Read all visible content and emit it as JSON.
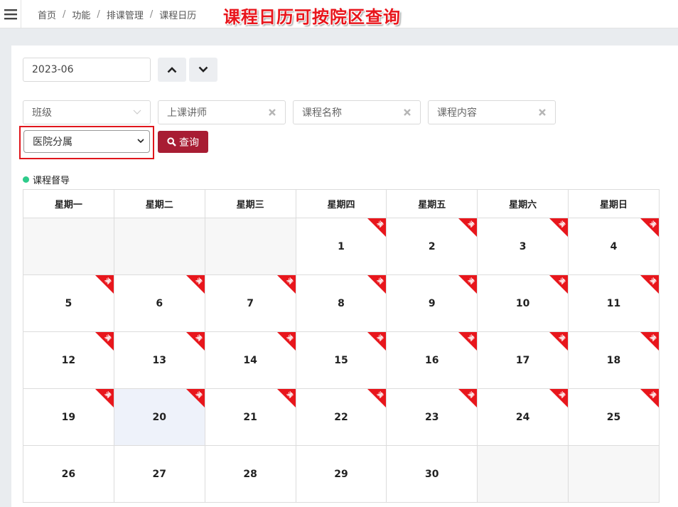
{
  "breadcrumb": [
    "首页",
    "功能",
    "排课管理",
    "课程日历"
  ],
  "annotation": "课程日历可按院区查询",
  "month_value": "2023-06",
  "filters": {
    "class_placeholder": "班级",
    "teacher_placeholder": "上课讲师",
    "course_name_placeholder": "课程名称",
    "course_content_placeholder": "课程内容",
    "hospital_selected": "医院分属"
  },
  "query_label": "查询",
  "legend_label": "课程督导",
  "weekdays": [
    "星期一",
    "星期二",
    "星期三",
    "星期四",
    "星期五",
    "星期六",
    "星期日"
  ],
  "weeks": [
    [
      null,
      null,
      null,
      1,
      2,
      3,
      4
    ],
    [
      5,
      6,
      7,
      8,
      9,
      10,
      11
    ],
    [
      12,
      13,
      14,
      15,
      16,
      17,
      18
    ],
    [
      19,
      20,
      21,
      22,
      23,
      24,
      25
    ],
    [
      26,
      27,
      28,
      29,
      30,
      null,
      null
    ]
  ],
  "today": 20,
  "corner_badge_text": "满",
  "corner_badge_days": [
    1,
    2,
    3,
    4,
    5,
    6,
    7,
    8,
    9,
    10,
    11,
    12,
    13,
    14,
    15,
    16,
    17,
    18,
    19,
    20,
    21,
    22,
    23,
    24,
    25
  ],
  "colors": {
    "badge": "#e8161c",
    "query_button": "#a81d33",
    "legend_dot": "#2ecb8b",
    "annotation": "#e8161c"
  }
}
